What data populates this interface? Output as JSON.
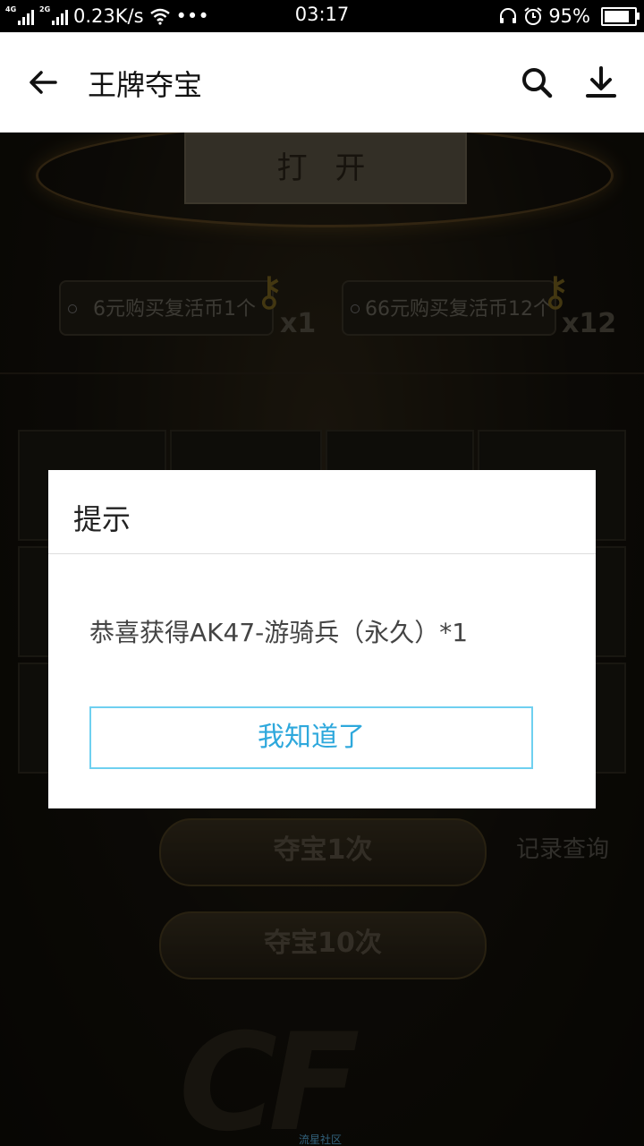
{
  "status_bar": {
    "network_1": "4G",
    "network_2": "2G",
    "speed": "0.23K/s",
    "more": "•••",
    "time": "03:17",
    "battery_percent": "95%",
    "battery_level": 0.95
  },
  "app_bar": {
    "title": "王牌夺宝"
  },
  "game": {
    "open_label": "打 开",
    "buy_options": [
      {
        "label": "6元购买复活币1个",
        "multiplier": "x1"
      },
      {
        "label": "66元购买复活币12个",
        "multiplier": "x12"
      }
    ],
    "draw_once_label": "夺宝1次",
    "draw_ten_label": "夺宝10次",
    "records_label": "记录查询",
    "logo_text": "CF",
    "watermark": "流星社区"
  },
  "dialog": {
    "title": "提示",
    "message": "恭喜获得AK47-游骑兵（永久）*1",
    "confirm_label": "我知道了"
  }
}
